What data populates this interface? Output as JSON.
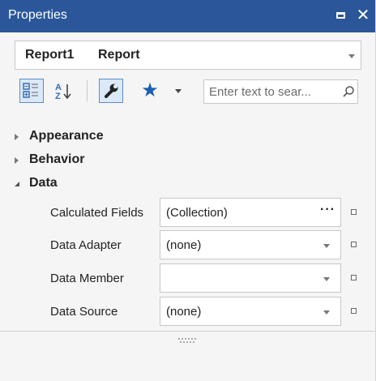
{
  "window": {
    "title": "Properties"
  },
  "selector": {
    "name": "Report1",
    "type": "Report"
  },
  "toolbar": {
    "icons": [
      "categorized-icon",
      "alphabetical-icon",
      "properties-wrench-icon",
      "favorites-star-icon",
      "chevron-down-icon"
    ],
    "search_placeholder": "Enter text to sear..."
  },
  "categories": [
    {
      "label": "Appearance",
      "expanded": false
    },
    {
      "label": "Behavior",
      "expanded": false
    },
    {
      "label": "Data",
      "expanded": true
    }
  ],
  "properties": [
    {
      "name": "Calculated Fields",
      "value": "(Collection)",
      "editor": "ellipsis"
    },
    {
      "name": "Data Adapter",
      "value": "(none)",
      "editor": "dropdown"
    },
    {
      "name": "Data Member",
      "value": "",
      "editor": "dropdown"
    },
    {
      "name": "Data Source",
      "value": "(none)",
      "editor": "dropdown"
    }
  ],
  "colors": {
    "titlebar": "#2b579a",
    "accent": "#1a5fb4",
    "panel": "#f5f5f5"
  }
}
